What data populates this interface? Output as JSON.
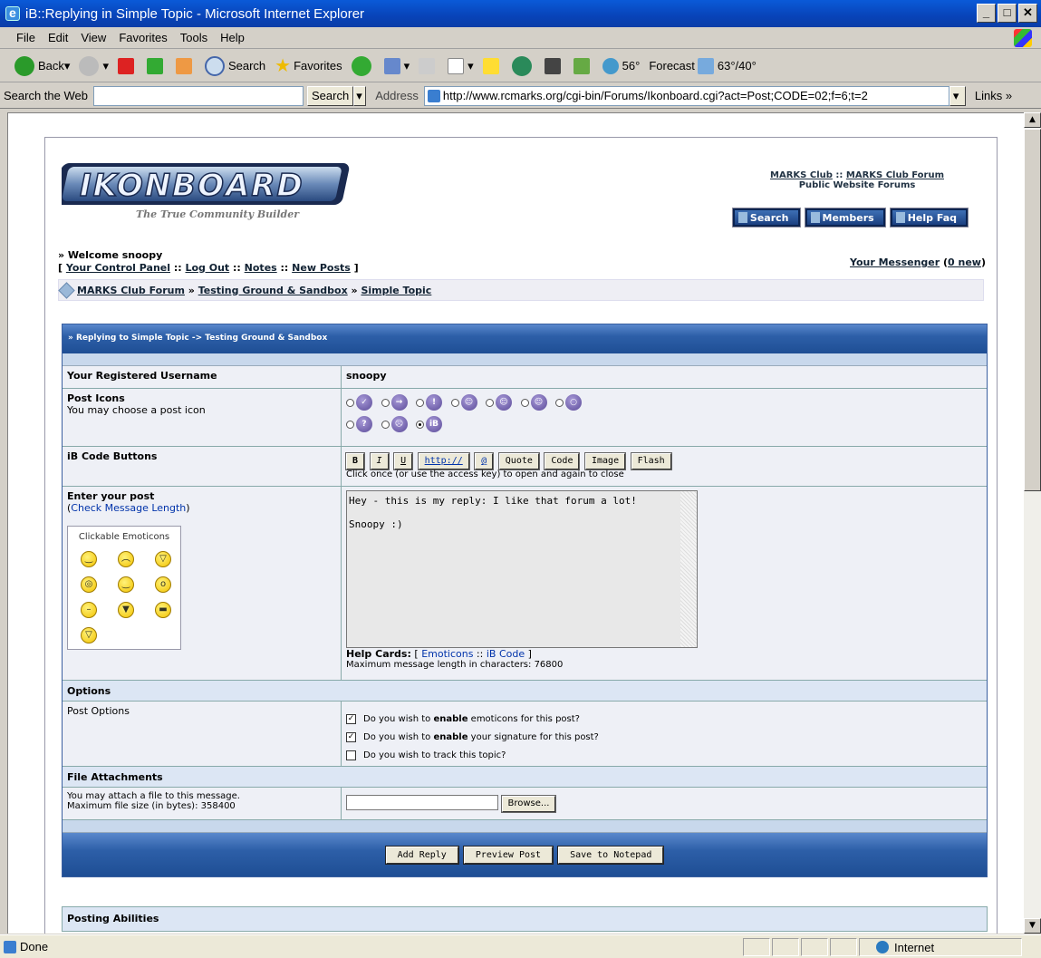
{
  "window": {
    "title": "iB::Replying in Simple Topic - Microsoft Internet Explorer"
  },
  "menu": [
    "File",
    "Edit",
    "View",
    "Favorites",
    "Tools",
    "Help"
  ],
  "toolbar": {
    "back": "Back",
    "search": "Search",
    "favorites": "Favorites",
    "weather": "56°",
    "forecast": "Forecast",
    "forecast_temp": "63°/40°"
  },
  "addressbar": {
    "search_label": "Search the Web",
    "search_button": "Search",
    "address_label": "Address",
    "url": "http://www.rcmarks.org/cgi-bin/Forums/Ikonboard.cgi?act=Post;CODE=02;f=6;t=2",
    "links": "Links"
  },
  "header": {
    "logo_text": "IKONBOARD",
    "tagline": "The True Community Builder",
    "club": "MARKS Club",
    "club_forum": "MARKS Club Forum",
    "sep": "::",
    "public": "Public Website Forums",
    "buttons": [
      "Search",
      "Members",
      "Help Faq"
    ]
  },
  "user": {
    "welcome": "» Welcome snoopy",
    "links": [
      "Your Control Panel",
      "Log Out",
      "Notes",
      "New Posts"
    ],
    "messenger": "Your Messenger",
    "messenger_count": "0 new"
  },
  "breadcrumb": [
    "MARKS Club Forum",
    "Testing Ground & Sandbox",
    "Simple Topic"
  ],
  "form": {
    "title": "» Replying to Simple Topic -> Testing Ground & Sandbox",
    "username_label": "Your Registered Username",
    "username": "snoopy",
    "post_icons_label": "Post Icons",
    "post_icons_hint": "You may choose a post icon",
    "post_icons_selected": "iB",
    "ibcode_label": "iB Code Buttons",
    "ibcode_buttons": [
      "B",
      "I",
      "U",
      "http://",
      "@",
      "Quote",
      "Code",
      "Image",
      "Flash"
    ],
    "ibcode_hint": "Click once (or use the access key) to open and again to close",
    "post_label": "Enter your post",
    "check_length": "Check Message Length",
    "emoticons_title": "Clickable Emoticons",
    "post_text": "Hey - this is my reply: I like that forum a lot!\n\nSnoopy :)",
    "help_cards_label": "Help Cards:",
    "help_emoticons": "Emoticons",
    "help_ibcode": "iB Code",
    "max_length": "Maximum message length in characters: 76800",
    "options_header": "Options",
    "post_options_label": "Post Options",
    "opt1_a": "Do you wish to ",
    "opt1_b": "enable",
    "opt1_c": " emoticons for this post?",
    "opt2_a": "Do you wish to ",
    "opt2_b": "enable",
    "opt2_c": " your signature for this post?",
    "opt3": "Do you wish to track this topic?",
    "attach_header": "File Attachments",
    "attach_line1": "You may attach a file to this message.",
    "attach_line2": "Maximum file size (in bytes): 358400",
    "browse": "Browse...",
    "add_reply": "Add Reply",
    "preview": "Preview Post",
    "notepad": "Save to Notepad",
    "abilities": "Posting Abilities"
  },
  "status": {
    "text": "Done",
    "zone": "Internet"
  }
}
